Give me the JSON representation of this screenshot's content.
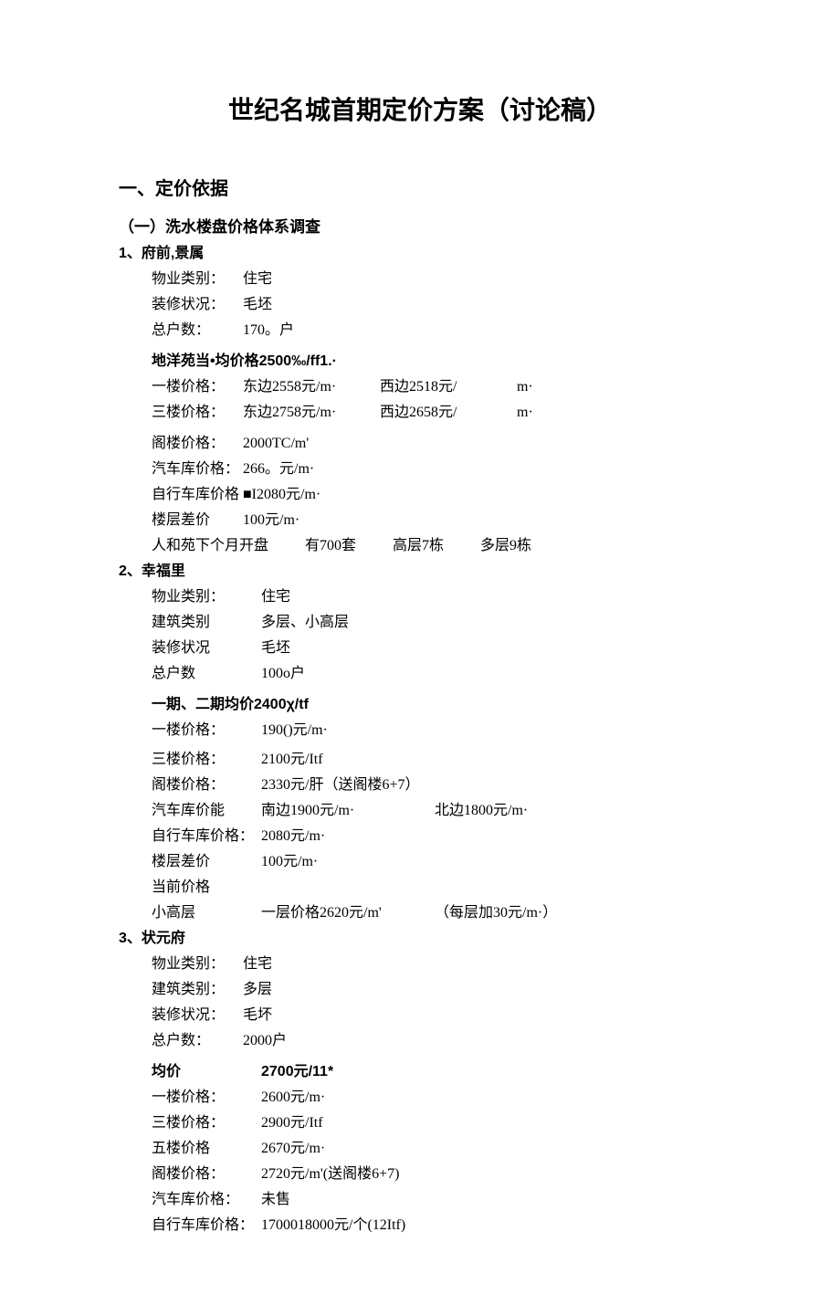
{
  "title": "世纪名城首期定价方案（讨论稿）",
  "sec1_title": "一、定价依据",
  "survey_title": "（一）洗水楼盘价格体系调查",
  "p1": {
    "num": "1、府前,景属",
    "type_lbl": "物业类别：",
    "type_val": "住宅",
    "deco_lbl": "装修状况：",
    "deco_val": "毛坯",
    "hh_lbl": "总户数：",
    "hh_val": "170。户",
    "avg_line": "地洋苑当•均价格2500‰/ff1.·",
    "f1_lbl": "一楼价格：",
    "f1_e": "东边2558元/m·",
    "f1_w": "西边2518元/",
    "f1_u": "m·",
    "f3_lbl": "三楼价格：",
    "f3_e": "东边2758元/m·",
    "f3_w": "西边2658元/",
    "f3_u": "m·",
    "attic_lbl": "阁楼价格：",
    "attic_val": "2000TC/m'",
    "garage_lbl": "汽车库价格：",
    "garage_val": "266。元/m·",
    "bike_lbl": "自行车库价格",
    "bike_val": "■I2080元/m·",
    "diff_lbl": "楼层差价",
    "diff_val": "100元/m·",
    "note_a": "人和苑下个月开盘",
    "note_b": "有700套",
    "note_c": "高层7栋",
    "note_d": "多层9栋"
  },
  "p2": {
    "num": "2、幸福里",
    "type_lbl": "物业类别：",
    "type_val": "住宅",
    "build_lbl": "建筑类别",
    "build_val": "多层、小高层",
    "deco_lbl": "装修状况",
    "deco_val": "毛坯",
    "hh_lbl": "总户数",
    "hh_val": "100o户",
    "avg_line": "一期、二期均价2400χ/tf",
    "f1_lbl": "一楼价格：",
    "f1_val": "190()元/m·",
    "f3_lbl": "三楼价格：",
    "f3_val": "2100元/Itf",
    "attic_lbl": "阁楼价格：",
    "attic_val": "2330元/肝（送阁楼6+7）",
    "garage_lbl": "汽车库价能",
    "garage_s": "南边1900元/m·",
    "garage_n": "北边1800元/m·",
    "bike_lbl": "自行车库价格：",
    "bike_val": "2080元/m·",
    "diff_lbl": "楼层差价",
    "diff_val": "100元/m·",
    "cur_lbl": "当前价格",
    "sh_lbl": "小高层",
    "sh_p": "一层价格2620元/m'",
    "sh_inc": "（每层加30元/m·）"
  },
  "p3": {
    "num": "3、状元府",
    "type_lbl": "物业类别：",
    "type_val": "住宅",
    "build_lbl": "建筑类别：",
    "build_val": "多层",
    "deco_lbl": "装修状况：",
    "deco_val": "毛坏",
    "hh_lbl": "总户数：",
    "hh_val": "2000户",
    "avg_lbl": "均价",
    "avg_val": "2700元/11*",
    "f1_lbl": "一楼价格：",
    "f1_val": "2600元/m·",
    "f3_lbl": "三楼价格：",
    "f3_val": "2900元/Itf",
    "f5_lbl": "五楼价格",
    "f5_val": "2670元/m·",
    "attic_lbl": "阁楼价格：",
    "attic_val": "2720元/m'(送阁楼6+7)",
    "garage_lbl": "汽车库价格：",
    "garage_val": "未售",
    "bike_lbl": "自行车库价格：",
    "bike_val": "1700018000元/个(12Itf)"
  }
}
